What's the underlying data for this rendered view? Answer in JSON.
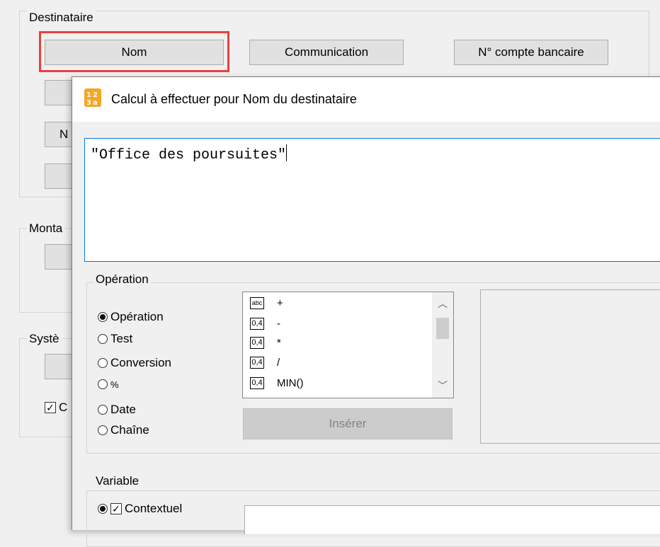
{
  "background": {
    "destinataire_label": "Destinataire",
    "btn_nom": "Nom",
    "btn_communication": "Communication",
    "btn_compte": "N° compte bancaire",
    "btn_partial_n": "N",
    "montant_label": "Monta",
    "systeme_label": "Systè",
    "checkbox_partial": "C"
  },
  "dialog": {
    "title": "Calcul à effectuer pour Nom du destinataire",
    "expression": "\"Office des poursuites\"",
    "operation_group_label": "Opération",
    "radios": [
      {
        "label": "Opération",
        "selected": true
      },
      {
        "label": "Test",
        "selected": false
      },
      {
        "label": "Conversion",
        "selected": false
      },
      {
        "label": "%",
        "selected": false
      },
      {
        "label": "Date",
        "selected": false
      },
      {
        "label": "Chaîne",
        "selected": false
      }
    ],
    "list_items": [
      {
        "icon": "abc",
        "label": "+"
      },
      {
        "icon": "0,4",
        "label": "-"
      },
      {
        "icon": "0,4",
        "label": "*"
      },
      {
        "icon": "0,4",
        "label": "/"
      },
      {
        "icon": "0,4",
        "label": "MIN()"
      }
    ],
    "insert_button": "Insérer",
    "variable_group_label": "Variable",
    "contextuel_label": "Contextuel",
    "colors": {
      "accent": "#0078d7",
      "highlight": "#e8413f"
    }
  }
}
